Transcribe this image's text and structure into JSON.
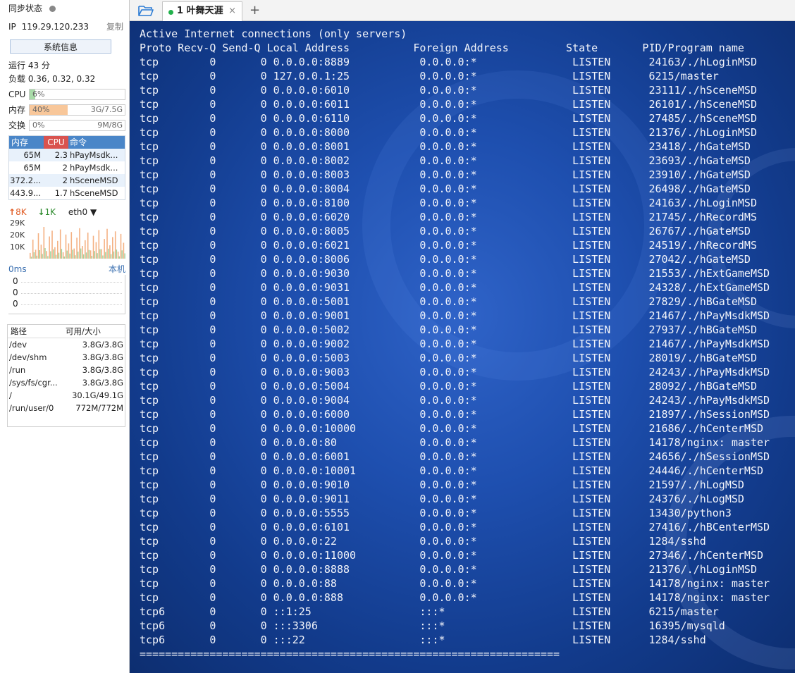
{
  "sidebar": {
    "sync_status": "同步状态",
    "ip_label": "IP",
    "ip": "119.29.120.233",
    "copy": "复制",
    "sysinfo": "系统信息",
    "uptime": "运行 43 分",
    "load": "负载 0.36, 0.32, 0.32",
    "meters": [
      {
        "label": "CPU",
        "pct": "6%",
        "value": 0.06,
        "total": "",
        "color": "#a8dba8"
      },
      {
        "label": "内存",
        "pct": "40%",
        "value": 0.4,
        "total": "3G/7.5G",
        "color": "#f8c79a"
      },
      {
        "label": "交换",
        "pct": "0%",
        "value": 0.0,
        "total": "9M/8G",
        "color": "#bbbbbb"
      }
    ],
    "proc_headers": {
      "mem": "内存",
      "cpu": "CPU",
      "cmd": "命令"
    },
    "processes": [
      {
        "mem": "65M",
        "cpu": "2.3",
        "cmd": "hPayMsdk..."
      },
      {
        "mem": "65M",
        "cpu": "2",
        "cmd": "hPayMsdk..."
      },
      {
        "mem": "372.2...",
        "cpu": "2",
        "cmd": "hSceneMSD"
      },
      {
        "mem": "443.9...",
        "cpu": "1.7",
        "cmd": "hSceneMSD"
      }
    ],
    "net": {
      "up": "8K",
      "down": "1K",
      "iface": "eth0",
      "ticks": [
        "29K",
        "20K",
        "10K"
      ]
    },
    "latency": {
      "value": "0ms",
      "host": "本机",
      "rows": [
        "0",
        "0",
        "0"
      ]
    },
    "disk_headers": {
      "path": "路径",
      "size": "可用/大小"
    },
    "disks": [
      {
        "path": "/dev",
        "size": "3.8G/3.8G"
      },
      {
        "path": "/dev/shm",
        "size": "3.8G/3.8G"
      },
      {
        "path": "/run",
        "size": "3.8G/3.8G"
      },
      {
        "path": "/sys/fs/cgr...",
        "size": "3.8G/3.8G"
      },
      {
        "path": "/",
        "size": "30.1G/49.1G"
      },
      {
        "path": "/run/user/0",
        "size": "772M/772M"
      }
    ]
  },
  "tabs": {
    "items": [
      {
        "label": "1 叶舞天涯"
      }
    ],
    "add": "+",
    "close": "×"
  },
  "terminal": {
    "title_line": "Active Internet connections (only servers)",
    "columns": [
      "Proto",
      "Recv-Q",
      "Send-Q",
      "Local Address",
      "Foreign Address",
      "State",
      "PID/Program name"
    ],
    "rows": [
      [
        "tcp",
        "0",
        "0",
        "0.0.0.0:8889",
        "0.0.0.0:*",
        "LISTEN",
        "24163/./hLoginMSD"
      ],
      [
        "tcp",
        "0",
        "0",
        "127.0.0.1:25",
        "0.0.0.0:*",
        "LISTEN",
        "6215/master"
      ],
      [
        "tcp",
        "0",
        "0",
        "0.0.0.0:6010",
        "0.0.0.0:*",
        "LISTEN",
        "23111/./hSceneMSD"
      ],
      [
        "tcp",
        "0",
        "0",
        "0.0.0.0:6011",
        "0.0.0.0:*",
        "LISTEN",
        "26101/./hSceneMSD"
      ],
      [
        "tcp",
        "0",
        "0",
        "0.0.0.0:6110",
        "0.0.0.0:*",
        "LISTEN",
        "27485/./hSceneMSD"
      ],
      [
        "tcp",
        "0",
        "0",
        "0.0.0.0:8000",
        "0.0.0.0:*",
        "LISTEN",
        "21376/./hLoginMSD"
      ],
      [
        "tcp",
        "0",
        "0",
        "0.0.0.0:8001",
        "0.0.0.0:*",
        "LISTEN",
        "23418/./hGateMSD"
      ],
      [
        "tcp",
        "0",
        "0",
        "0.0.0.0:8002",
        "0.0.0.0:*",
        "LISTEN",
        "23693/./hGateMSD"
      ],
      [
        "tcp",
        "0",
        "0",
        "0.0.0.0:8003",
        "0.0.0.0:*",
        "LISTEN",
        "23910/./hGateMSD"
      ],
      [
        "tcp",
        "0",
        "0",
        "0.0.0.0:8004",
        "0.0.0.0:*",
        "LISTEN",
        "26498/./hGateMSD"
      ],
      [
        "tcp",
        "0",
        "0",
        "0.0.0.0:8100",
        "0.0.0.0:*",
        "LISTEN",
        "24163/./hLoginMSD"
      ],
      [
        "tcp",
        "0",
        "0",
        "0.0.0.0:6020",
        "0.0.0.0:*",
        "LISTEN",
        "21745/./hRecordMS"
      ],
      [
        "tcp",
        "0",
        "0",
        "0.0.0.0:8005",
        "0.0.0.0:*",
        "LISTEN",
        "26767/./hGateMSD"
      ],
      [
        "tcp",
        "0",
        "0",
        "0.0.0.0:6021",
        "0.0.0.0:*",
        "LISTEN",
        "24519/./hRecordMS"
      ],
      [
        "tcp",
        "0",
        "0",
        "0.0.0.0:8006",
        "0.0.0.0:*",
        "LISTEN",
        "27042/./hGateMSD"
      ],
      [
        "tcp",
        "0",
        "0",
        "0.0.0.0:9030",
        "0.0.0.0:*",
        "LISTEN",
        "21553/./hExtGameMSD"
      ],
      [
        "tcp",
        "0",
        "0",
        "0.0.0.0:9031",
        "0.0.0.0:*",
        "LISTEN",
        "24328/./hExtGameMSD"
      ],
      [
        "tcp",
        "0",
        "0",
        "0.0.0.0:5001",
        "0.0.0.0:*",
        "LISTEN",
        "27829/./hBGateMSD"
      ],
      [
        "tcp",
        "0",
        "0",
        "0.0.0.0:9001",
        "0.0.0.0:*",
        "LISTEN",
        "21467/./hPayMsdkMSD"
      ],
      [
        "tcp",
        "0",
        "0",
        "0.0.0.0:5002",
        "0.0.0.0:*",
        "LISTEN",
        "27937/./hBGateMSD"
      ],
      [
        "tcp",
        "0",
        "0",
        "0.0.0.0:9002",
        "0.0.0.0:*",
        "LISTEN",
        "21467/./hPayMsdkMSD"
      ],
      [
        "tcp",
        "0",
        "0",
        "0.0.0.0:5003",
        "0.0.0.0:*",
        "LISTEN",
        "28019/./hBGateMSD"
      ],
      [
        "tcp",
        "0",
        "0",
        "0.0.0.0:9003",
        "0.0.0.0:*",
        "LISTEN",
        "24243/./hPayMsdkMSD"
      ],
      [
        "tcp",
        "0",
        "0",
        "0.0.0.0:5004",
        "0.0.0.0:*",
        "LISTEN",
        "28092/./hBGateMSD"
      ],
      [
        "tcp",
        "0",
        "0",
        "0.0.0.0:9004",
        "0.0.0.0:*",
        "LISTEN",
        "24243/./hPayMsdkMSD"
      ],
      [
        "tcp",
        "0",
        "0",
        "0.0.0.0:6000",
        "0.0.0.0:*",
        "LISTEN",
        "21897/./hSessionMSD"
      ],
      [
        "tcp",
        "0",
        "0",
        "0.0.0.0:10000",
        "0.0.0.0:*",
        "LISTEN",
        "21686/./hCenterMSD"
      ],
      [
        "tcp",
        "0",
        "0",
        "0.0.0.0:80",
        "0.0.0.0:*",
        "LISTEN",
        "14178/nginx: master"
      ],
      [
        "tcp",
        "0",
        "0",
        "0.0.0.0:6001",
        "0.0.0.0:*",
        "LISTEN",
        "24656/./hSessionMSD"
      ],
      [
        "tcp",
        "0",
        "0",
        "0.0.0.0:10001",
        "0.0.0.0:*",
        "LISTEN",
        "24446/./hCenterMSD"
      ],
      [
        "tcp",
        "0",
        "0",
        "0.0.0.0:9010",
        "0.0.0.0:*",
        "LISTEN",
        "21597/./hLogMSD"
      ],
      [
        "tcp",
        "0",
        "0",
        "0.0.0.0:9011",
        "0.0.0.0:*",
        "LISTEN",
        "24376/./hLogMSD"
      ],
      [
        "tcp",
        "0",
        "0",
        "0.0.0.0:5555",
        "0.0.0.0:*",
        "LISTEN",
        "13430/python3"
      ],
      [
        "tcp",
        "0",
        "0",
        "0.0.0.0:6101",
        "0.0.0.0:*",
        "LISTEN",
        "27416/./hBCenterMSD"
      ],
      [
        "tcp",
        "0",
        "0",
        "0.0.0.0:22",
        "0.0.0.0:*",
        "LISTEN",
        "1284/sshd"
      ],
      [
        "tcp",
        "0",
        "0",
        "0.0.0.0:11000",
        "0.0.0.0:*",
        "LISTEN",
        "27346/./hCenterMSD"
      ],
      [
        "tcp",
        "0",
        "0",
        "0.0.0.0:8888",
        "0.0.0.0:*",
        "LISTEN",
        "21376/./hLoginMSD"
      ],
      [
        "tcp",
        "0",
        "0",
        "0.0.0.0:88",
        "0.0.0.0:*",
        "LISTEN",
        "14178/nginx: master"
      ],
      [
        "tcp",
        "0",
        "0",
        "0.0.0.0:888",
        "0.0.0.0:*",
        "LISTEN",
        "14178/nginx: master"
      ],
      [
        "tcp6",
        "0",
        "0",
        "::1:25",
        ":::*",
        "LISTEN",
        "6215/master"
      ],
      [
        "tcp6",
        "0",
        "0",
        ":::3306",
        ":::*",
        "LISTEN",
        "16395/mysqld"
      ],
      [
        "tcp6",
        "0",
        "0",
        ":::22",
        ":::*",
        "LISTEN",
        "1284/sshd"
      ]
    ],
    "separator": "=================================================================="
  }
}
